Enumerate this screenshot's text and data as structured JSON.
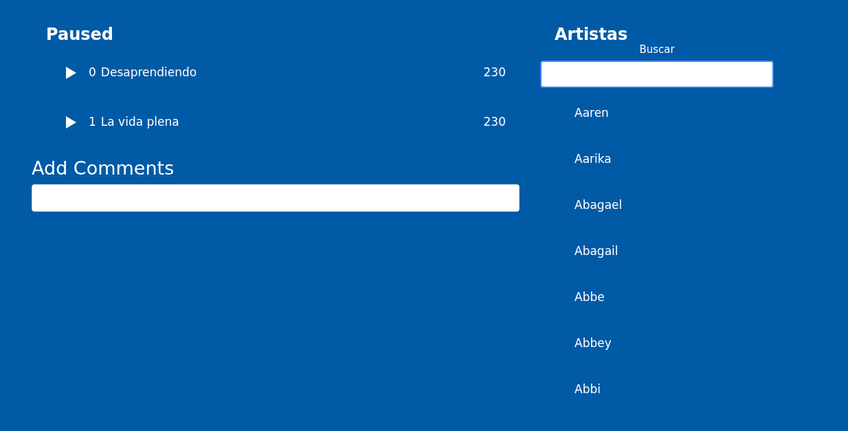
{
  "player": {
    "title": "Paused",
    "tracks": [
      {
        "index": "0",
        "title": "Desaprendiendo",
        "duration": "230"
      },
      {
        "index": "1",
        "title": "La vida plena",
        "duration": "230"
      }
    ]
  },
  "comments": {
    "title": "Add Comments"
  },
  "artists": {
    "title": "Artistas",
    "search": {
      "label": "Buscar"
    },
    "items": [
      "Aaren",
      "Aarika",
      "Abagael",
      "Abagail",
      "Abbe",
      "Abbey",
      "Abbi"
    ]
  }
}
